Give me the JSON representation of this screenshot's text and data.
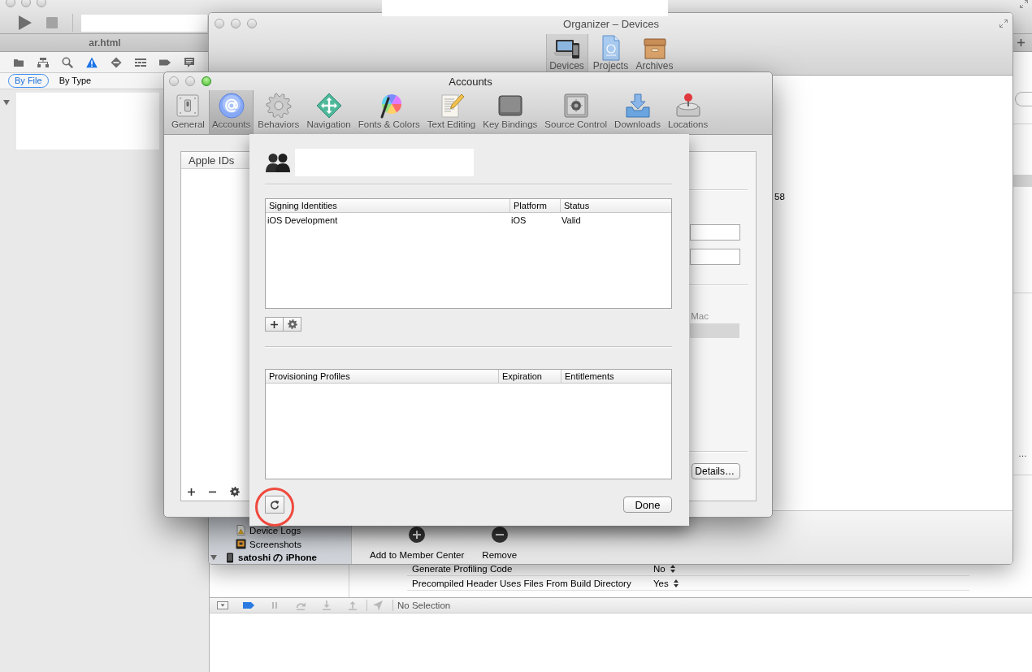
{
  "xcode_window": {
    "active": false,
    "editor_tab": "ar.html",
    "navigator_tabs": [
      {
        "kind": "project",
        "selected": false
      },
      {
        "kind": "symbol",
        "selected": false
      },
      {
        "kind": "find",
        "selected": false
      },
      {
        "kind": "issue",
        "selected": true
      },
      {
        "kind": "test",
        "selected": false
      },
      {
        "kind": "debug",
        "selected": false
      },
      {
        "kind": "breakpoint",
        "selected": false
      },
      {
        "kind": "log",
        "selected": false
      }
    ],
    "issue_filter": [
      {
        "label": "By File",
        "selected": true
      },
      {
        "label": "By Type",
        "selected": false
      }
    ],
    "issue_tree": {
      "expanded": true
    },
    "build_settings": [
      {
        "name": "Generate Profiling Code",
        "value": "No"
      },
      {
        "name": "Precompiled Header Uses Files From Build Directory",
        "value": "Yes"
      }
    ],
    "debug_bar": {
      "breakpoints_active": true,
      "status": "No Selection"
    },
    "inspector_fragment": "…"
  },
  "organizer_window": {
    "active": false,
    "title": "Organizer – Devices",
    "toolbar": [
      {
        "kind": "devices",
        "label": "Devices",
        "selected": true
      },
      {
        "kind": "projects",
        "label": "Projects",
        "selected": false
      },
      {
        "kind": "archives",
        "label": "Archives",
        "selected": false
      }
    ],
    "sidebar": {
      "items": [
        {
          "kind": "logs",
          "label": "Device Logs"
        },
        {
          "kind": "screenshots",
          "label": "Screenshots"
        }
      ],
      "device": {
        "label": "satoshi の iPhone",
        "expanded": true
      }
    },
    "detail_fragment": "58",
    "actions": [
      {
        "kind": "add",
        "label": "Add to Member Center"
      },
      {
        "kind": "remove",
        "label": "Remove"
      }
    ]
  },
  "accounts_window": {
    "traffic_lights": [
      {
        "kind": "close",
        "enabled": false
      },
      {
        "kind": "minimize",
        "enabled": false
      },
      {
        "kind": "zoom",
        "enabled": true
      }
    ],
    "title": "Accounts",
    "toolbar": [
      {
        "kind": "general",
        "label": "General",
        "selected": false
      },
      {
        "kind": "accounts",
        "label": "Accounts",
        "selected": true
      },
      {
        "kind": "behaviors",
        "label": "Behaviors",
        "selected": false
      },
      {
        "kind": "navigation",
        "label": "Navigation",
        "selected": false
      },
      {
        "kind": "fonts",
        "label": "Fonts & Colors",
        "selected": false
      },
      {
        "kind": "text",
        "label": "Text Editing",
        "selected": false
      },
      {
        "kind": "keys",
        "label": "Key Bindings",
        "selected": false
      },
      {
        "kind": "source",
        "label": "Source Control",
        "selected": false
      },
      {
        "kind": "downloads",
        "label": "Downloads",
        "selected": false
      },
      {
        "kind": "locations",
        "label": "Locations",
        "selected": false
      }
    ],
    "apple_ids": {
      "header": "Apple IDs"
    },
    "detail": {
      "column_label": "Mac",
      "button": "Details…"
    },
    "sheet": {
      "signing_identities": {
        "columns": [
          "Signing Identities",
          "Platform",
          "Status"
        ],
        "rows": [
          [
            "iOS Development",
            "iOS",
            "Valid"
          ]
        ]
      },
      "provisioning_profiles": {
        "columns": [
          "Provisioning Profiles",
          "Expiration",
          "Entitlements"
        ]
      },
      "refresh_highlighted": true,
      "done_button": "Done"
    }
  }
}
